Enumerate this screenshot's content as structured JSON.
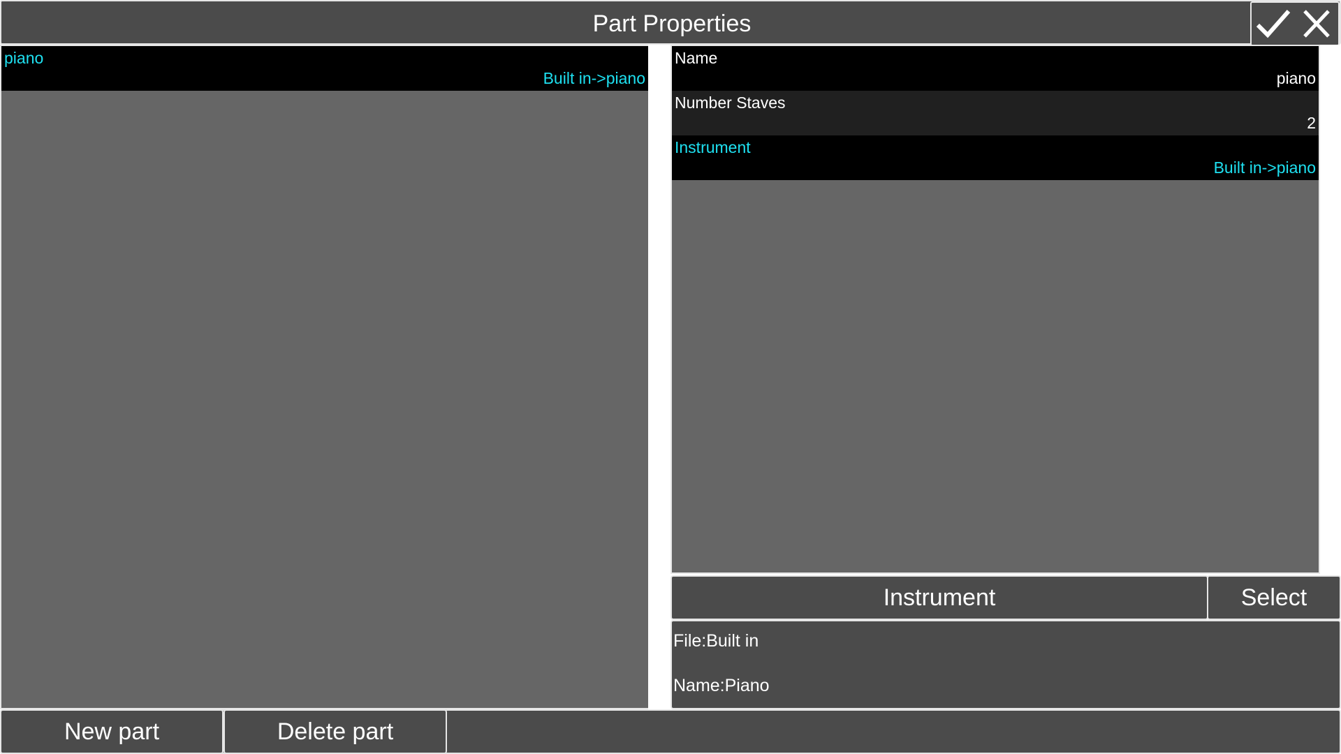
{
  "window": {
    "title": "Part Properties",
    "confirm_icon": "checkmark-icon",
    "close_icon": "close-icon"
  },
  "parts_list": [
    {
      "name": "piano",
      "instrument": "Built in->piano"
    }
  ],
  "properties": [
    {
      "label": "Name",
      "value": "piano"
    },
    {
      "label": "Number Staves",
      "value": "2"
    },
    {
      "label": "Instrument",
      "value": "Built in->piano"
    }
  ],
  "instrument_section": {
    "header": "Instrument",
    "select_label": "Select",
    "file_line": "File:Built in",
    "name_line": "Name:Piano"
  },
  "bottom_buttons": {
    "new_part": "New part",
    "delete_part": "Delete part"
  },
  "colors": {
    "accent_cyan": "#1ee0f0",
    "panel_bg": "#666666",
    "button_bg": "#4b4b4b",
    "row_bg": "#000000",
    "row_alt_bg": "#202020"
  }
}
